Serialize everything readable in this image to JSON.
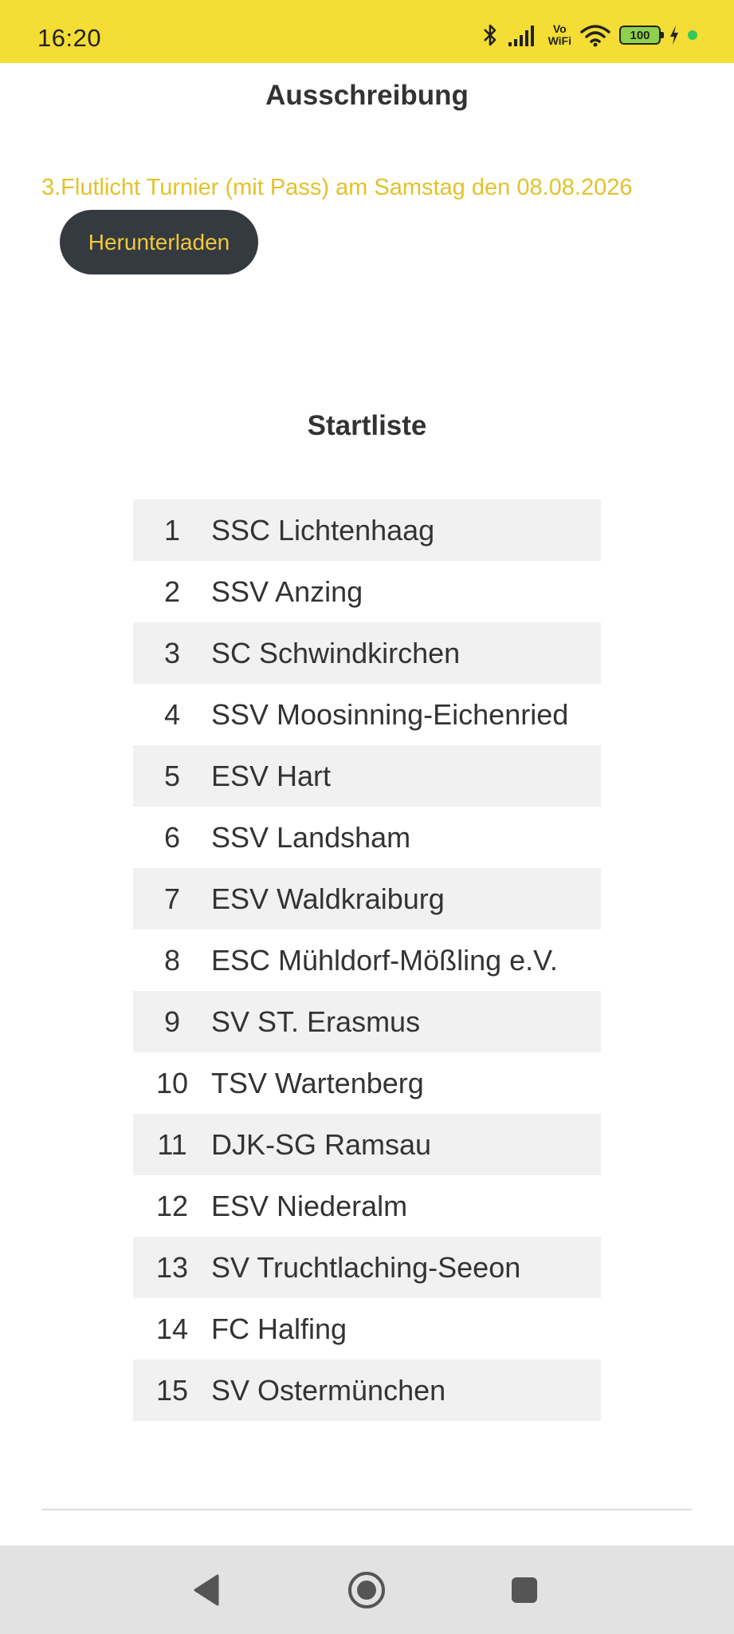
{
  "status_bar": {
    "time": "16:20",
    "vowifi_top": "Vo",
    "vowifi_bottom": "WiFi",
    "battery_level": "100",
    "icons": [
      "bluetooth-icon",
      "signal-icon",
      "vowifi-icon",
      "wifi-icon",
      "battery-icon",
      "charging-icon"
    ]
  },
  "header": {
    "title": "Ausschreibung"
  },
  "announcement": {
    "text": "3.Flutlicht Turnier (mit Pass) am Samstag den 08.08.2026",
    "download_label": "Herunterladen"
  },
  "startlist": {
    "title": "Startliste",
    "entries": [
      {
        "num": "1",
        "name": "SSC Lichtenhaag"
      },
      {
        "num": "2",
        "name": "SSV Anzing"
      },
      {
        "num": "3",
        "name": "SC Schwindkirchen"
      },
      {
        "num": "4",
        "name": "SSV Moosinning-Eichenried"
      },
      {
        "num": "5",
        "name": "ESV Hart"
      },
      {
        "num": "6",
        "name": "SSV Landsham"
      },
      {
        "num": "7",
        "name": "ESV Waldkraiburg"
      },
      {
        "num": "8",
        "name": "ESC Mühldorf-Mößling e.V."
      },
      {
        "num": "9",
        "name": "SV ST. Erasmus"
      },
      {
        "num": "10",
        "name": "TSV Wartenberg"
      },
      {
        "num": "11",
        "name": "DJK-SG Ramsau"
      },
      {
        "num": "12",
        "name": "ESV Niederalm"
      },
      {
        "num": "13",
        "name": "SV Truchtlaching-Seeon"
      },
      {
        "num": "14",
        "name": "FC Halfing"
      },
      {
        "num": "15",
        "name": "SV Ostermünchen"
      }
    ]
  },
  "colors": {
    "status_bar": "#f4dd34",
    "accent_text": "#e2c22b",
    "button_bg": "#343a40",
    "button_text": "#f0c93b",
    "stripe": "#f1f1f1"
  },
  "nav_bar": {
    "icons": [
      "back-icon",
      "home-icon",
      "recent-apps-icon"
    ]
  }
}
